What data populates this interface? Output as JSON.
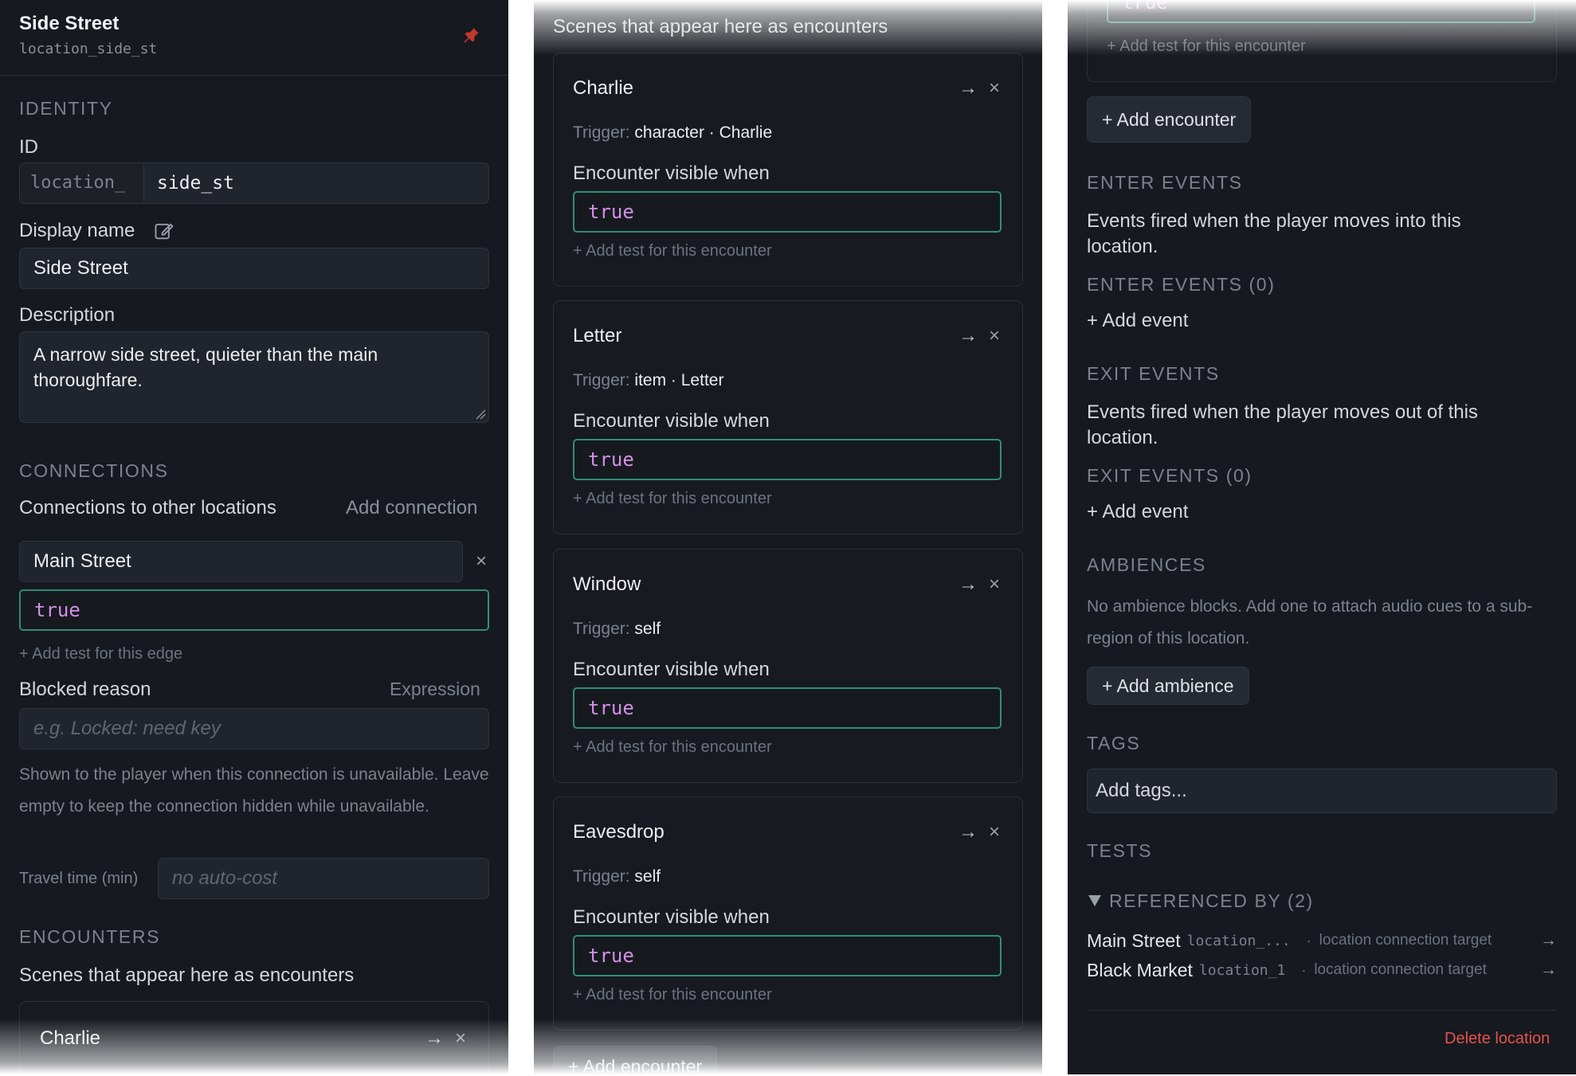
{
  "header": {
    "title": "Side Street",
    "subtitle": "location_side_st"
  },
  "identity": {
    "section": "IDENTITY",
    "id_label": "ID",
    "id_prefix": "location_",
    "id_value": "side_st",
    "display_name_label": "Display name",
    "display_name_value": "Side Street",
    "description_label": "Description",
    "description_value": "A narrow side street, quieter than the main thoroughfare."
  },
  "connections": {
    "section": "CONNECTIONS",
    "label": "Connections to other locations",
    "add_label": "Add connection",
    "items": [
      {
        "target": "Main Street",
        "condition": "true"
      }
    ],
    "add_test_label": "+ Add test for this edge",
    "blocked_label": "Blocked reason",
    "expression_label": "Expression",
    "blocked_placeholder": "e.g. Locked: need key",
    "help_text": "Shown to the player when this connection is unavailable. Leave empty to keep the connection hidden while unavailable.",
    "travel_label": "Travel time (min)",
    "travel_placeholder": "no auto-cost"
  },
  "encounters": {
    "section": "ENCOUNTERS",
    "label": "Scenes that appear here as encounters",
    "first_item": "Charlie",
    "trigger_prefix": "Trigger:",
    "visible_label": "Encounter visible when",
    "add_test_label": "+ Add test for this encounter",
    "items": [
      {
        "name": "Charlie",
        "trigger": "character · Charlie",
        "condition": "true"
      },
      {
        "name": "Letter",
        "trigger": "item · Letter",
        "condition": "true"
      },
      {
        "name": "Window",
        "trigger": "self",
        "condition": "true"
      },
      {
        "name": "Eavesdrop",
        "trigger": "self",
        "condition": "true"
      }
    ],
    "partial_condition": "true",
    "add_encounter_label": "+ Add encounter"
  },
  "enter_events": {
    "section": "ENTER EVENTS",
    "desc": "Events fired when the player moves into this location.",
    "count_label": "ENTER EVENTS (0)",
    "add_label": "+ Add event"
  },
  "exit_events": {
    "section": "EXIT EVENTS",
    "desc": "Events fired when the player moves out of this location.",
    "count_label": "EXIT EVENTS (0)",
    "add_label": "+ Add event"
  },
  "ambiences": {
    "section": "AMBIENCES",
    "desc": "No ambience blocks. Add one to attach audio cues to a sub-region of this location.",
    "add_label": "+ Add ambience"
  },
  "tags": {
    "section": "TAGS",
    "placeholder": "Add tags..."
  },
  "tests": {
    "section": "TESTS",
    "referenced_label": "REFERENCED BY (2)",
    "refs": [
      {
        "name": "Main Street",
        "id": "location_...",
        "kind": "location connection target"
      },
      {
        "name": "Black Market",
        "id": "location_1",
        "kind": "location connection target"
      }
    ],
    "separator": "·"
  },
  "delete_label": "Delete location",
  "icons": {
    "pin": "pin-icon",
    "edit": "edit-icon",
    "go": "arrow-right-icon",
    "close": "close-icon",
    "triangle": "triangle-down-icon"
  },
  "colors": {
    "panel_bg": "#161920",
    "condition_border": "#2f8f73",
    "condition_text": "#d58ee8",
    "danger": "#e5534b",
    "pin": "#c0392b"
  }
}
